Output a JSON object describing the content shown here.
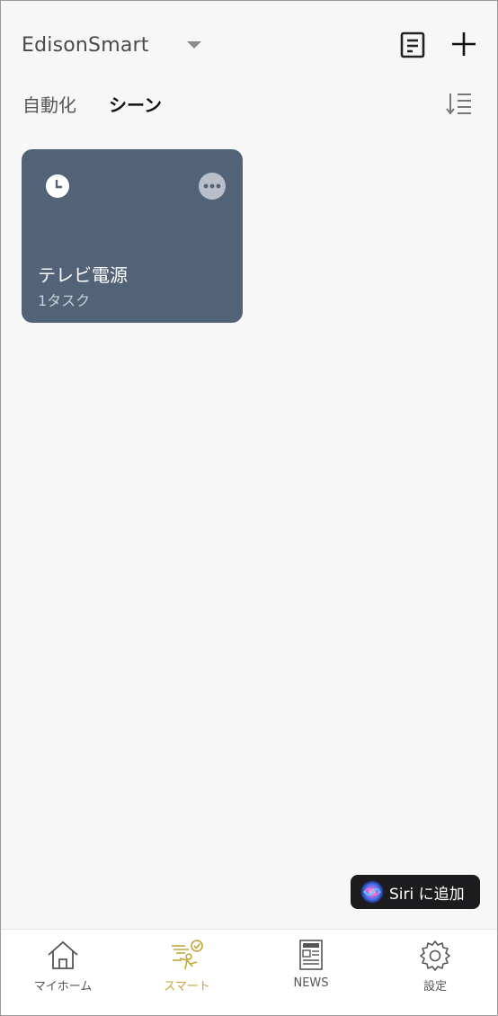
{
  "header": {
    "home_name": "EdisonSmart"
  },
  "tabs": [
    {
      "label": "自動化",
      "active": false
    },
    {
      "label": "シーン",
      "active": true
    }
  ],
  "scenes": [
    {
      "name": "テレビ電源",
      "task_count": "1タスク",
      "icon": "clock-icon",
      "color": "#526277"
    }
  ],
  "siri": {
    "label": "Siri に追加"
  },
  "tabbar": {
    "items": [
      {
        "label": "マイホーム",
        "icon": "home-icon"
      },
      {
        "label": "スマート",
        "icon": "smart-icon",
        "active": true
      },
      {
        "label": "NEWS",
        "icon": "news-icon"
      },
      {
        "label": "設定",
        "icon": "gear-icon"
      }
    ]
  },
  "colors": {
    "accent": "#c4a637",
    "background": "#f7f7f7",
    "card": "#526277"
  }
}
